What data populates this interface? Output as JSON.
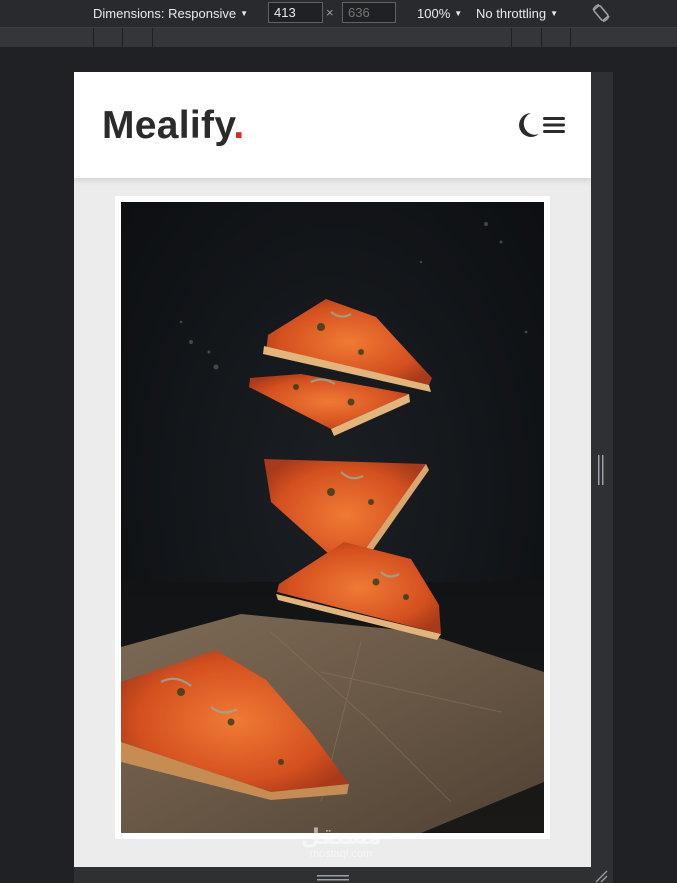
{
  "devtools": {
    "dimensions_label": "Dimensions: Responsive",
    "width_value": "413",
    "height_placeholder": "636",
    "times": "×",
    "zoom_label": "100%",
    "throttling_label": "No throttling",
    "rotate_icon": "rotate-icon"
  },
  "site": {
    "logo_text": "Mealify",
    "logo_dot": ".",
    "logo_dot_color": "#d62828",
    "dark_mode_icon": "moon-icon",
    "menu_icon": "hamburger-menu-icon"
  },
  "hero": {
    "image_subject": "photo-pizza-slices-dark-background"
  },
  "watermark": {
    "main": "مستقل",
    "sub": "mostaql.com"
  }
}
